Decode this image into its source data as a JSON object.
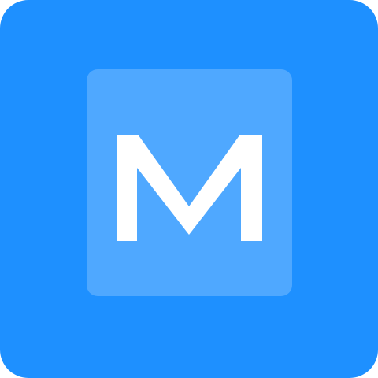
{
  "app_icon": {
    "icon_name": "m-letter-icon",
    "logo_letter": "M",
    "colors": {
      "background": "#1e90ff",
      "inner_square": "rgba(255,255,255,0.22)",
      "glyph": "#ffffff"
    }
  }
}
